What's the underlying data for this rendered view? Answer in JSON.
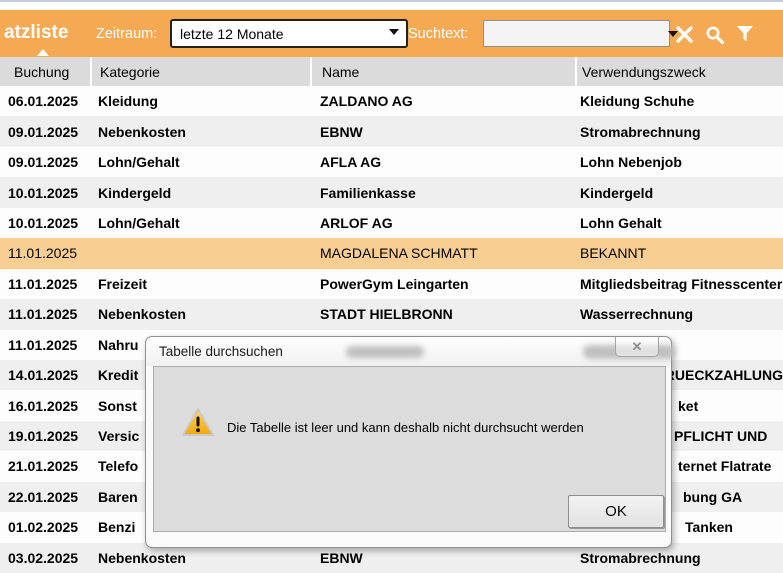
{
  "header": {
    "title_fragment": "atzliste",
    "zeitraum_label": "Zeitraum:",
    "zeitraum_value": "letzte 12 Monate",
    "suchtext_label": "Suchtext:",
    "suchtext_value": ""
  },
  "icons": [
    "clear-x-icon",
    "search-magnifier-icon",
    "filter-funnel-icon",
    "sort-ascending-icon",
    "warning-triangle-icon",
    "dialog-close-icon"
  ],
  "table": {
    "columns": [
      "Buchung",
      "Kategorie",
      "Name",
      "Verwendungszweck"
    ],
    "sort": {
      "column": "Buchung",
      "direction": "ascending"
    },
    "rows": [
      {
        "buchung": "06.01.2025",
        "kategorie": "Kleidung",
        "name": "ZALDANO AG",
        "zweck": "Kleidung Schuhe"
      },
      {
        "buchung": "09.01.2025",
        "kategorie": "Nebenkosten",
        "name": "EBNW",
        "zweck": "Stromabrechnung"
      },
      {
        "buchung": "09.01.2025",
        "kategorie": "Lohn/Gehalt",
        "name": "AFLA AG",
        "zweck": "Lohn Nebenjob"
      },
      {
        "buchung": "10.01.2025",
        "kategorie": "Kindergeld",
        "name": "Familienkasse",
        "zweck": "Kindergeld"
      },
      {
        "buchung": "10.01.2025",
        "kategorie": "Lohn/Gehalt",
        "name": "ARLOF AG",
        "zweck": "Lohn Gehalt"
      },
      {
        "buchung": "11.01.2025",
        "kategorie": "",
        "name": "MAGDALENA SCHMATT",
        "zweck": "BEKANNT",
        "selected": true
      },
      {
        "buchung": "11.01.2025",
        "kategorie": "Freizeit",
        "name": "PowerGym Leingarten",
        "zweck": "Mitgliedsbeitrag Fitnesscenter"
      },
      {
        "buchung": "11.01.2025",
        "kategorie": "Nebenkosten",
        "name": "STADT HIELBRONN",
        "zweck": "Wasserrechnung"
      },
      {
        "buchung": "11.01.2025",
        "kategorie": "Nahru",
        "name": "",
        "zweck": ""
      },
      {
        "buchung": "14.01.2025",
        "kategorie": "Kredit",
        "name": "",
        "zweck": "RUECKZAHLUNG",
        "zweck_indent": 91
      },
      {
        "buchung": "16.01.2025",
        "kategorie": "Sonst",
        "name": "",
        "zweck": "ket",
        "zweck_indent": 103
      },
      {
        "buchung": "19.01.2025",
        "kategorie": "Versic",
        "name": "",
        "zweck": "PFLICHT UND",
        "zweck_indent": 99
      },
      {
        "buchung": "21.01.2025",
        "kategorie": "Telefo",
        "name": "",
        "zweck": "ternet Flatrate",
        "zweck_indent": 103
      },
      {
        "buchung": "22.01.2025",
        "kategorie": "Baren",
        "name": "",
        "zweck": "bung GA",
        "zweck_indent": 108
      },
      {
        "buchung": "01.02.2025",
        "kategorie": "Benzi",
        "name": "",
        "zweck": "Tanken",
        "zweck_indent": 110
      },
      {
        "buchung": "03.02.2025",
        "kategorie": "Nebenkosten",
        "name": "EBNW",
        "zweck": "Stromabrechnung"
      }
    ]
  },
  "dialog": {
    "title": "Tabelle durchsuchen",
    "message": "Die Tabelle ist leer und kann deshalb nicht durchsucht werden",
    "ok_label": "OK"
  },
  "colors": {
    "accent_orange": "#F5A953",
    "selected_row_orange": "#F8CE93",
    "table_header_gray": "#DBDBDB",
    "row_stripe_gray": "#EFEFEF",
    "dialog_panel_gray": "#DCDCDC",
    "warning_yellow": "#FFC20E"
  }
}
